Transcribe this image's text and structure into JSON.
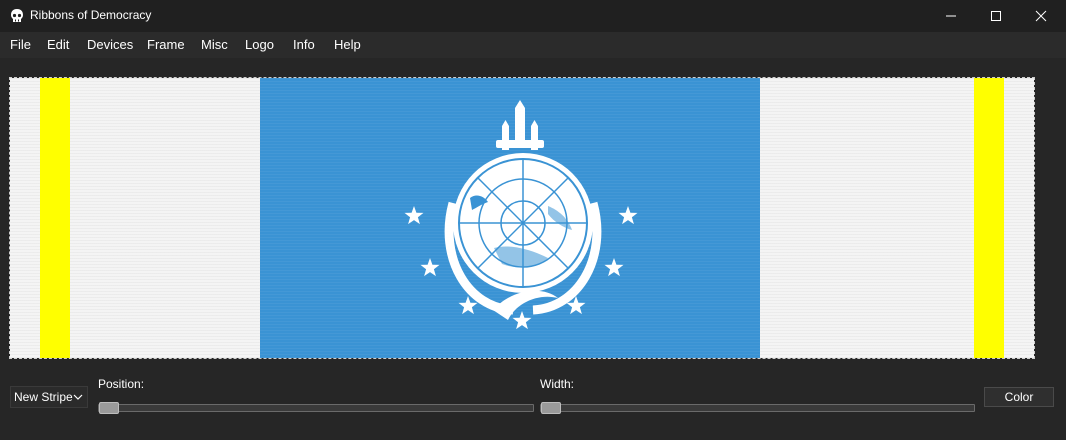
{
  "window": {
    "title": "Ribbons of Democracy",
    "icon": "skull-icon",
    "controls": [
      "minimize-icon",
      "maximize-icon",
      "close-icon"
    ]
  },
  "menu": {
    "items": [
      "File",
      "Edit",
      "Devices",
      "Frame",
      "Misc",
      "Logo",
      "Info",
      "Help"
    ]
  },
  "ribbon": {
    "background_color": "#f4f4f4",
    "stripes": [
      {
        "name": "yellow-left",
        "color": "#ffff00"
      },
      {
        "name": "blue-center",
        "color": "#3a93d4"
      },
      {
        "name": "yellow-right",
        "color": "#ffff00"
      }
    ],
    "logo": "super-earth-globe-emblem",
    "logo_color": "#ffffff"
  },
  "controls": {
    "stripe_select": {
      "value": "New Stripe"
    },
    "position": {
      "label": "Position:",
      "value": 0.0
    },
    "width": {
      "label": "Width:",
      "value": 0.0
    },
    "color_button": "Color"
  }
}
